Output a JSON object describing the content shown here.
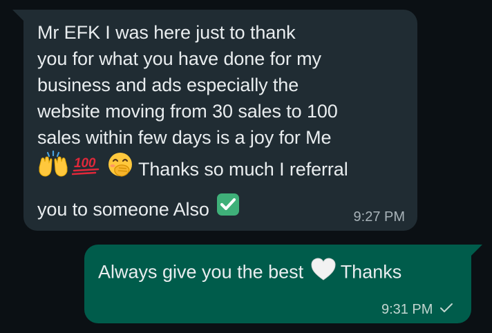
{
  "incoming": {
    "lines": [
      "Mr EFK I was here just to thank",
      "you for what you have done for my",
      "business and ads especially the",
      "website moving from 30 sales to 100",
      "sales within few days is a joy for Me"
    ],
    "line6": "Thanks so much I referral",
    "line7": "you to someone Also",
    "emoji_raised_hands": "raised-hands-icon",
    "emoji_hundred": "100",
    "emoji_face": "face-with-hand-over-mouth-icon",
    "emoji_check": "check-mark-button-icon",
    "time": "9:27 PM"
  },
  "outgoing": {
    "text_before": "Always give you the best",
    "text_after": "Thanks",
    "emoji_heart": "white-heart-icon",
    "time": "9:31 PM",
    "status_icon": "sent-check-icon"
  },
  "colors": {
    "background": "#0b1014",
    "incoming_bubble": "#202c33",
    "outgoing_bubble": "#005c4b",
    "text": "#e9edef",
    "meta": "#a8b3b9"
  }
}
